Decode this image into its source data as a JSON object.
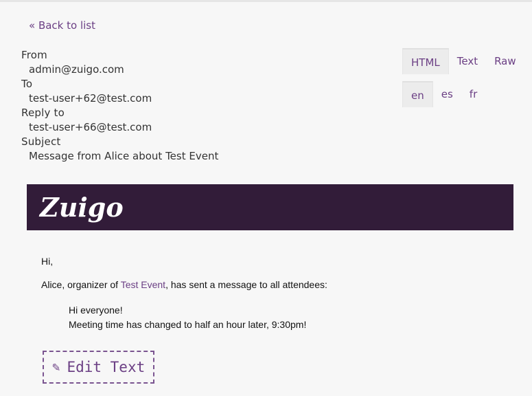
{
  "nav": {
    "back_label": "« Back to list"
  },
  "meta": {
    "from_label": "From",
    "from_value": "admin@zuigo.com",
    "to_label": "To",
    "to_value": "test-user+62@test.com",
    "reply_to_label": "Reply to",
    "reply_to_value": "test-user+66@test.com",
    "subject_label": "Subject",
    "subject_value": "Message from Alice about Test Event"
  },
  "view_tabs": [
    {
      "label": "HTML",
      "active": true
    },
    {
      "label": "Text",
      "active": false
    },
    {
      "label": "Raw",
      "active": false
    }
  ],
  "language_tabs": [
    {
      "label": "en",
      "active": true
    },
    {
      "label": "es",
      "active": false
    },
    {
      "label": "fr",
      "active": false
    }
  ],
  "email": {
    "brand_logo": "Zuigo",
    "greeting": "Hi,",
    "intro_prefix": "Alice, organizer of ",
    "event_link": "Test Event",
    "intro_suffix": ", has sent a message to all attendees:",
    "quote_line1": "Hi everyone!",
    "quote_line2": "Meeting time has changed to half an hour later, 9:30pm!",
    "edit_label": "Edit Text",
    "edit_icon": "pencil-icon"
  },
  "colors": {
    "accent": "#6b3f84",
    "header_bg": "#321c39",
    "page_bg": "#f7f7f7"
  }
}
